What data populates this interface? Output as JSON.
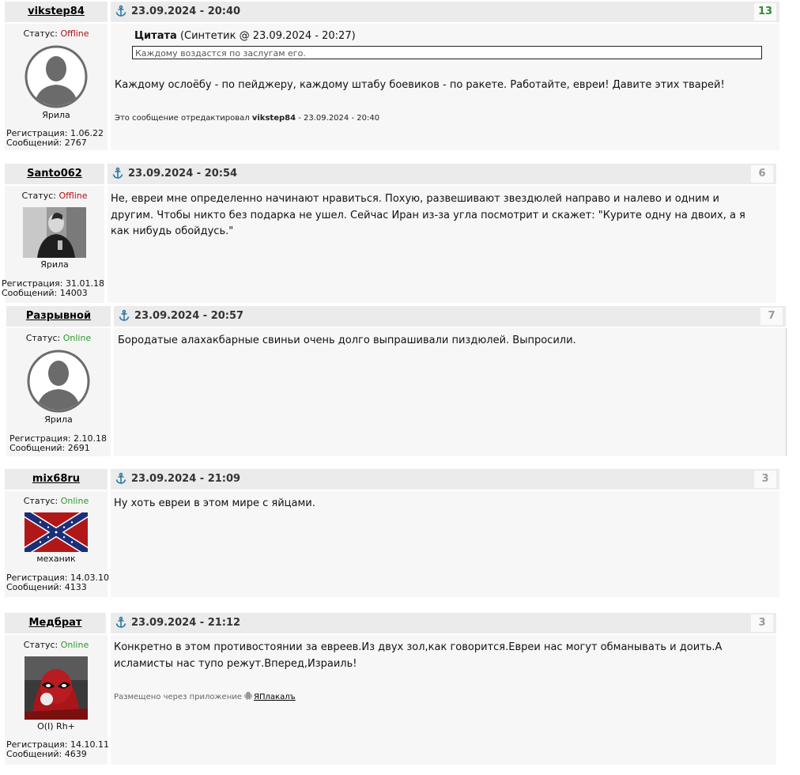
{
  "labels": {
    "status": "Статус: ",
    "registration": "Регистрация: ",
    "messages": "Сообщений: "
  },
  "colors": {
    "header_bg": "#ebebeb",
    "offline": "#b01010",
    "online": "#2a9a2a",
    "positive_rating": "#2e8b2e"
  },
  "posts": [
    {
      "author": "vikstep84",
      "datetime": "23.09.2024 - 20:40",
      "rating": "13",
      "status": "Offline",
      "avatar": "default-avatar-icon",
      "rank": "Ярила",
      "registration": "1.06.22",
      "messages": "2767",
      "quote": {
        "label": "Цитата",
        "source": "(Синтетик @ 23.09.2024 - 20:27)",
        "text": "Каждому воздастся по заслугам его."
      },
      "text": "Каждому ослоёбу - по пейджеру, каждому штабу боевиков - по ракете. Работайте, евреи! Давите этих тварей!",
      "edited_prefix": "Это сообщение отредактировал ",
      "edited_by": "vikstep84",
      "edited_suffix": " - 23.09.2024 - 20:40"
    },
    {
      "author": "Santo062",
      "datetime": "23.09.2024 - 20:54",
      "rating": "6",
      "status": "Offline",
      "avatar": "user-photo",
      "rank": "Ярила",
      "registration": "31.01.18",
      "messages": "14003",
      "text_lines": [
        "Не, евреи мне определенно начинают нравиться. Похую, развешивают звездюлей направо и налево и одним и",
        "другим. Чтобы никто без подарка не ушел. Сейчас Иран из-за угла посмотрит и скажет: \"Курите одну на двоих, а я",
        "как нибудь обойдусь.\""
      ]
    },
    {
      "author": "Разрывной",
      "datetime": "23.09.2024 - 20:57",
      "rating": "7",
      "status": "Online",
      "avatar": "default-avatar-icon",
      "rank": "Ярила",
      "registration": "2.10.18",
      "messages": "2691",
      "text": "Бородатые алахакбарные свиньи очень долго выпрашивали пиздюлей. Выпросили."
    },
    {
      "author": "mix68ru",
      "datetime": "23.09.2024 - 21:09",
      "rating": "3",
      "status": "Online",
      "avatar": "confederate-flag",
      "rank": "механик",
      "registration": "14.03.10",
      "messages": "4133",
      "text": "Ну хоть евреи в этом мире с яйцами."
    },
    {
      "author": "Медбрат",
      "datetime": "23.09.2024 - 21:12",
      "rating": "3",
      "status": "Online",
      "avatar": "deadpool-image",
      "rank": "O(I) Rh+",
      "registration": "14.10.11",
      "messages": "4639",
      "text_lines": [
        "Конкретно в этом противостоянии за евреев.Из двух зол,как говорится.Евреи нас могут обманывать и доить.А",
        "исламисты нас тупо режут.Вперед,Израиль!"
      ],
      "via_prefix": "Размещено через приложение ",
      "via_app": "ЯПлакалъ"
    }
  ]
}
